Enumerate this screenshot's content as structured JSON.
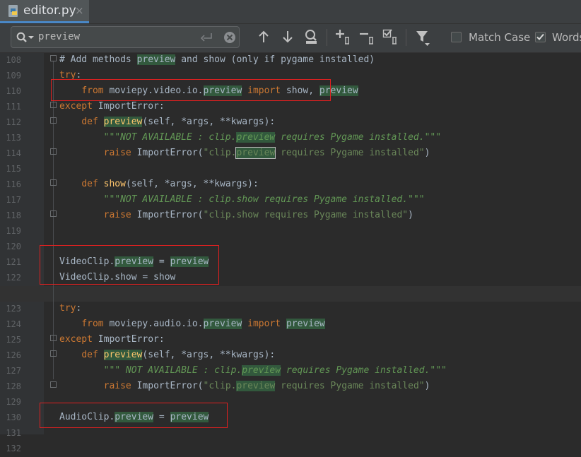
{
  "tab": {
    "title": "editor.py",
    "close": "×"
  },
  "find": {
    "query": "preview",
    "match_case_label": "Match Case",
    "words_label": "Words",
    "match_case_checked": false,
    "words_checked": true
  },
  "lines": [
    {
      "num": "108",
      "tokens": [
        {
          "t": "# Add methods ",
          "c": "cm"
        },
        {
          "t": "preview",
          "c": "hl"
        },
        {
          "t": " and show (only if pygame installed)",
          "c": "cm"
        }
      ]
    },
    {
      "num": "109",
      "tokens": [
        {
          "t": "try",
          "c": "kw"
        },
        {
          "t": ":",
          "c": ""
        }
      ]
    },
    {
      "num": "110",
      "tokens": [
        {
          "t": "    ",
          "c": ""
        },
        {
          "t": "from",
          "c": "kw"
        },
        {
          "t": " moviepy.video.io.",
          "c": ""
        },
        {
          "t": "preview",
          "c": "hl"
        },
        {
          "t": " ",
          "c": ""
        },
        {
          "t": "import",
          "c": "kw"
        },
        {
          "t": " show, ",
          "c": ""
        },
        {
          "t": "preview",
          "c": "hl"
        }
      ]
    },
    {
      "num": "111",
      "tokens": [
        {
          "t": "except",
          "c": "kw"
        },
        {
          "t": " ImportError:",
          "c": ""
        }
      ]
    },
    {
      "num": "112",
      "tokens": [
        {
          "t": "    ",
          "c": ""
        },
        {
          "t": "def",
          "c": "kw"
        },
        {
          "t": " ",
          "c": ""
        },
        {
          "t": "preview",
          "c": "hlfn"
        },
        {
          "t": "(self, *args, **kwargs):",
          "c": ""
        }
      ]
    },
    {
      "num": "113",
      "tokens": [
        {
          "t": "        \"\"\"NOT AVAILABLE : clip.",
          "c": "doc"
        },
        {
          "t": "preview",
          "c": "hldoc"
        },
        {
          "t": " requires Pygame installed.\"\"\"",
          "c": "doc"
        }
      ]
    },
    {
      "num": "114",
      "tokens": [
        {
          "t": "        ",
          "c": ""
        },
        {
          "t": "raise",
          "c": "kw"
        },
        {
          "t": " ImportError(",
          "c": ""
        },
        {
          "t": "\"clip.",
          "c": "str"
        },
        {
          "t": "preview",
          "c": "hlcur"
        },
        {
          "t": " requires Pygame installed\"",
          "c": "str"
        },
        {
          "t": ")",
          "c": ""
        }
      ]
    },
    {
      "num": "115",
      "tokens": []
    },
    {
      "num": "116",
      "tokens": [
        {
          "t": "    ",
          "c": ""
        },
        {
          "t": "def",
          "c": "kw"
        },
        {
          "t": " ",
          "c": ""
        },
        {
          "t": "show",
          "c": "fn"
        },
        {
          "t": "(self, *args, **kwargs):",
          "c": ""
        }
      ]
    },
    {
      "num": "117",
      "tokens": [
        {
          "t": "        \"\"\"NOT AVAILABLE : clip.show requires Pygame installed.\"\"\"",
          "c": "doc"
        }
      ]
    },
    {
      "num": "118",
      "tokens": [
        {
          "t": "        ",
          "c": ""
        },
        {
          "t": "raise",
          "c": "kw"
        },
        {
          "t": " ImportError(",
          "c": ""
        },
        {
          "t": "\"clip.show requires Pygame installed\"",
          "c": "str"
        },
        {
          "t": ")",
          "c": ""
        }
      ]
    },
    {
      "num": "119",
      "tokens": []
    },
    {
      "num": "120",
      "tokens": []
    },
    {
      "num": "121",
      "tokens": [
        {
          "t": "VideoClip.",
          "c": ""
        },
        {
          "t": "preview",
          "c": "hl"
        },
        {
          "t": " = ",
          "c": ""
        },
        {
          "t": "preview",
          "c": "hl"
        }
      ]
    },
    {
      "num": "122",
      "tokens": [
        {
          "t": "VideoClip.show = show",
          "c": ""
        }
      ]
    },
    {
      "num": "",
      "tokens": [],
      "caret": true
    },
    {
      "num": "123",
      "tokens": [
        {
          "t": "try",
          "c": "kw"
        },
        {
          "t": ":",
          "c": ""
        }
      ]
    },
    {
      "num": "124",
      "tokens": [
        {
          "t": "    ",
          "c": ""
        },
        {
          "t": "from",
          "c": "kw"
        },
        {
          "t": " moviepy.audio.io.",
          "c": ""
        },
        {
          "t": "preview",
          "c": "hl"
        },
        {
          "t": " ",
          "c": ""
        },
        {
          "t": "import",
          "c": "kw"
        },
        {
          "t": " ",
          "c": ""
        },
        {
          "t": "preview",
          "c": "hl"
        }
      ]
    },
    {
      "num": "125",
      "tokens": [
        {
          "t": "except",
          "c": "kw"
        },
        {
          "t": " ImportError:",
          "c": ""
        }
      ]
    },
    {
      "num": "126",
      "tokens": [
        {
          "t": "    ",
          "c": ""
        },
        {
          "t": "def",
          "c": "kw"
        },
        {
          "t": " ",
          "c": ""
        },
        {
          "t": "preview",
          "c": "hlfn"
        },
        {
          "t": "(self, *args, **kwargs):",
          "c": ""
        }
      ]
    },
    {
      "num": "127",
      "tokens": [
        {
          "t": "        \"\"\" NOT AVAILABLE : clip.",
          "c": "doc"
        },
        {
          "t": "preview",
          "c": "hldoc"
        },
        {
          "t": " requires Pygame installed.\"\"\"",
          "c": "doc"
        }
      ]
    },
    {
      "num": "128",
      "tokens": [
        {
          "t": "        ",
          "c": ""
        },
        {
          "t": "raise",
          "c": "kw"
        },
        {
          "t": " ImportError(",
          "c": ""
        },
        {
          "t": "\"clip.",
          "c": "str"
        },
        {
          "t": "preview",
          "c": "hlstr"
        },
        {
          "t": " requires Pygame installed\"",
          "c": "str"
        },
        {
          "t": ")",
          "c": ""
        }
      ]
    },
    {
      "num": "129",
      "tokens": []
    },
    {
      "num": "130",
      "tokens": [
        {
          "t": "AudioClip.",
          "c": ""
        },
        {
          "t": "preview",
          "c": "hl"
        },
        {
          "t": " = ",
          "c": ""
        },
        {
          "t": "preview",
          "c": "hl"
        }
      ]
    },
    {
      "num": "131",
      "tokens": []
    },
    {
      "num": "132",
      "tokens": []
    }
  ]
}
